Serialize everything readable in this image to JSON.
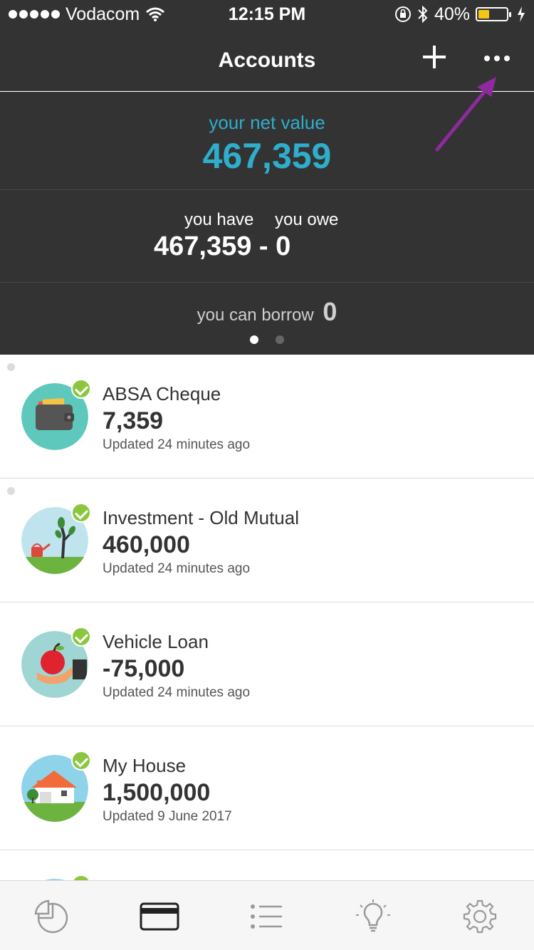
{
  "status_bar": {
    "carrier": "Vodacom",
    "time": "12:15 PM",
    "battery_percent": "40%",
    "battery_level": 0.4,
    "icons": [
      "signal-dots-icon",
      "wifi-icon",
      "orientation-lock-icon",
      "bluetooth-icon",
      "battery-icon",
      "charging-icon"
    ]
  },
  "header": {
    "title": "Accounts",
    "add_icon": "plus-icon",
    "more_icon": "ellipsis-icon"
  },
  "summary": {
    "net_label": "your net value",
    "net_value": "467,359",
    "have_label": "you have",
    "owe_label": "you owe",
    "have_owe_value": "467,359 - 0",
    "borrow_label": "you can borrow",
    "borrow_value": "0",
    "pager_pages": 2,
    "pager_active": 1
  },
  "accounts": [
    {
      "name": "ABSA Cheque",
      "amount": "7,359",
      "updated": "Updated 24 minutes ago",
      "icon": "wallet-icon"
    },
    {
      "name": "Investment - Old Mutual",
      "amount": "460,000",
      "updated": "Updated 24 minutes ago",
      "icon": "tree-watering-can-icon"
    },
    {
      "name": "Vehicle Loan",
      "amount": "-75,000",
      "updated": "Updated 24 minutes ago",
      "icon": "hand-apple-icon"
    },
    {
      "name": "My House",
      "amount": "1,500,000",
      "updated": "Updated 9 June 2017",
      "icon": "house-icon"
    }
  ],
  "tabbar": {
    "tabs": [
      "pie-chart-icon",
      "card-icon",
      "list-icon",
      "lightbulb-icon",
      "gear-icon"
    ],
    "active": "card-icon"
  },
  "colors": {
    "dark_bg": "#333333",
    "accent_blue": "#2eaecb",
    "check_green": "#8cc63f",
    "annotation_arrow": "#8e2a9e"
  }
}
